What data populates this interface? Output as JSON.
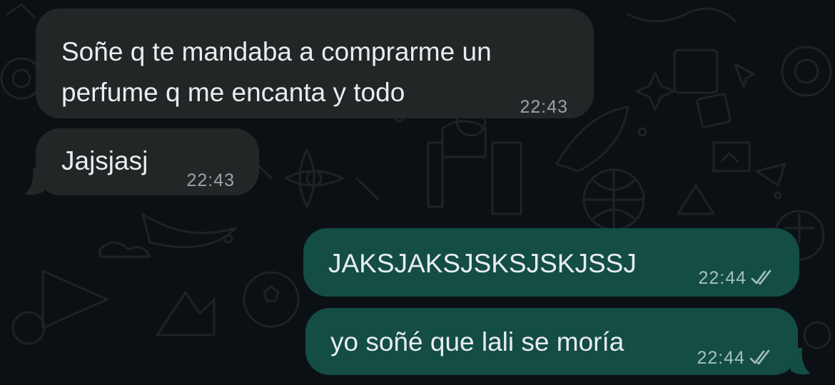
{
  "colors": {
    "background": "#0b1014",
    "incoming_bubble": "#232626",
    "outgoing_bubble": "#134d44",
    "message_text": "#e9edef",
    "timestamp_text": "#9aa3a7"
  },
  "messages": [
    {
      "direction": "incoming",
      "lines": [
        "Soñe q te mandaba a comprarme un",
        "perfume q me encanta y todo"
      ],
      "time": "22:43"
    },
    {
      "direction": "incoming",
      "lines": [
        "Jajsjasj"
      ],
      "time": "22:43"
    },
    {
      "direction": "outgoing",
      "lines": [
        "JAKSJAKSJSKSJSKJSSJ"
      ],
      "time": "22:44",
      "status_icon": "double-check-icon"
    },
    {
      "direction": "outgoing",
      "lines": [
        "yo soñé que lali se moría"
      ],
      "time": "22:44",
      "status_icon": "double-check-icon"
    }
  ]
}
